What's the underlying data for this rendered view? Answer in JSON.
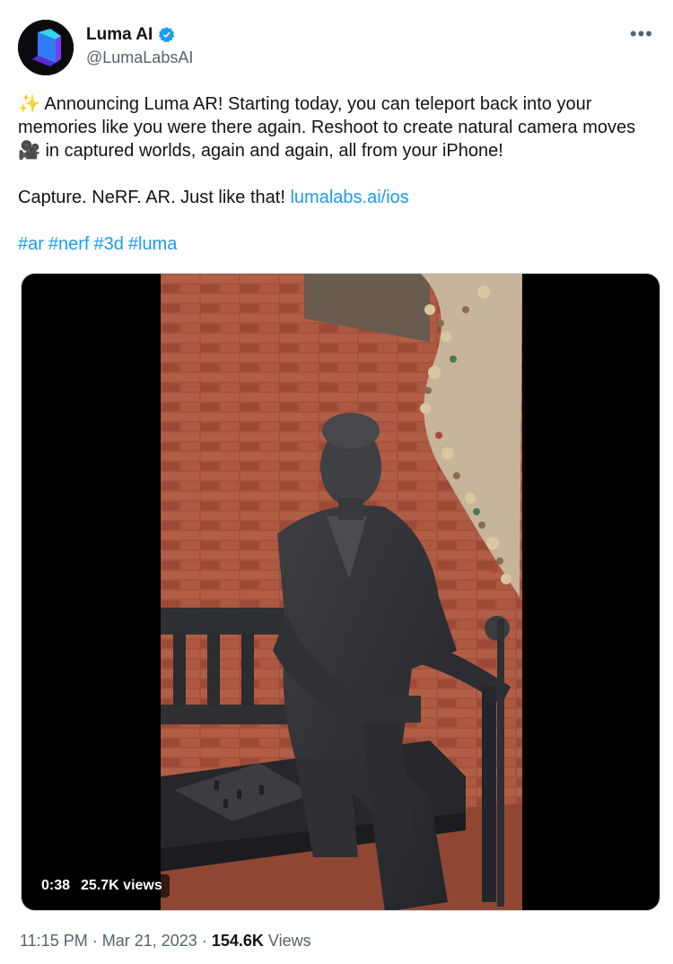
{
  "author": {
    "name": "Luma AI",
    "handle": "@LumaLabsAI",
    "verified_icon": "verified-badge-icon"
  },
  "more_label": "•••",
  "tweet": {
    "line1": "Announcing Luma AR! Starting today, you can teleport back into your memories like you were there again. Reshoot to create natural camera moves",
    "line1_emoji": "✨",
    "camera_emoji": "🎥",
    "line1_tail": "in captured worlds, again and again, all from your iPhone!",
    "line2": "Capture. NeRF. AR. Just like that!",
    "link": "lumalabs.ai/ios",
    "hashtags": [
      "#ar",
      "#nerf",
      "#3d",
      "#luma"
    ]
  },
  "video": {
    "duration": "0:38",
    "views": "25.7K views"
  },
  "footer": {
    "time": "11:15 PM",
    "separator": "·",
    "date": "Mar 21, 2023",
    "view_count": "154.6K",
    "views_label": "Views"
  },
  "colors": {
    "link": "#1d9bf0",
    "secondary_text": "#536471",
    "brick": "#a4533d"
  }
}
